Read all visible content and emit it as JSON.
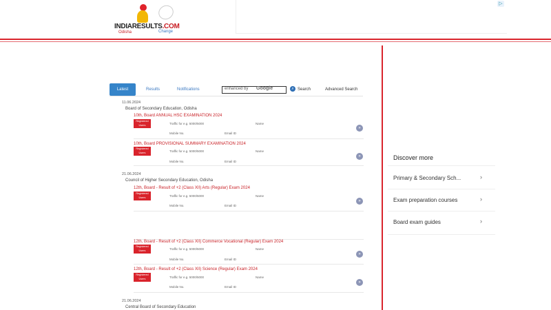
{
  "header": {
    "logo_text": "INDIARESULTS",
    "logo_suffix": ".COM",
    "state_label": "Odisha",
    "change_label": "Change",
    "ad_badge": "▷"
  },
  "tabs": {
    "latest": "Latest",
    "results": "Results",
    "notifications": "Notifications"
  },
  "search": {
    "prefix": "enhanced by",
    "google": "Google",
    "button": "Search",
    "advanced": "Advanced Search"
  },
  "list": {
    "groups": [
      {
        "date": "11.06.2024",
        "board": "Board of Secondary Education, Odisha"
      },
      {
        "date": "21.06.2024",
        "board": "Council of Higher Secondary Education, Odisha"
      },
      {
        "date": "21.06.2024",
        "board": "Central Board of Secondary Education"
      }
    ],
    "items": [
      {
        "title": "10th, Board ANNUAL HSC EXAMINATION 2024",
        "badge": "Registered Users",
        "meta_a": "Traffic for e.g. 5000/5000",
        "meta_b": "Name",
        "meta_c": "Mobile No.",
        "meta_d": "Email ID"
      },
      {
        "title": "10th, Board PROVISIONAL SUMMARY EXAMINATION 2024",
        "badge": "Registered Users",
        "meta_a": "Traffic for e.g. 5000/5000",
        "meta_b": "Name",
        "meta_c": "Mobile No.",
        "meta_d": "Email ID"
      },
      {
        "title": "12th, Board - Result of +2 (Class XII) Arts (Regular) Exam 2024",
        "badge": "Registered Users",
        "meta_a": "Traffic for e.g. 5000/5000",
        "meta_b": "Name",
        "meta_c": "Mobile No.",
        "meta_d": "Email ID"
      },
      {
        "title": "12th, Board - Result of +2 (Class XII) Commerce Vocational (Regular) Exam 2024",
        "badge": "Registered Users",
        "meta_a": "Traffic for e.g. 5000/5000",
        "meta_b": "Name",
        "meta_c": "Mobile No.",
        "meta_d": "Email ID"
      },
      {
        "title": "12th, Board - Result of +2 (Class XII) Science (Regular) Exam 2024",
        "badge": "Registered Users",
        "meta_a": "Traffic for e.g. 5000/5000",
        "meta_b": "Name",
        "meta_c": "Mobile No.",
        "meta_d": "Email ID"
      }
    ],
    "go_glyph": "»"
  },
  "sidebar": {
    "title": "Discover more",
    "links": [
      {
        "label": "Primary & Secondary Sch..."
      },
      {
        "label": "Exam preparation courses"
      },
      {
        "label": "Board exam guides"
      }
    ],
    "chevron": "›"
  }
}
